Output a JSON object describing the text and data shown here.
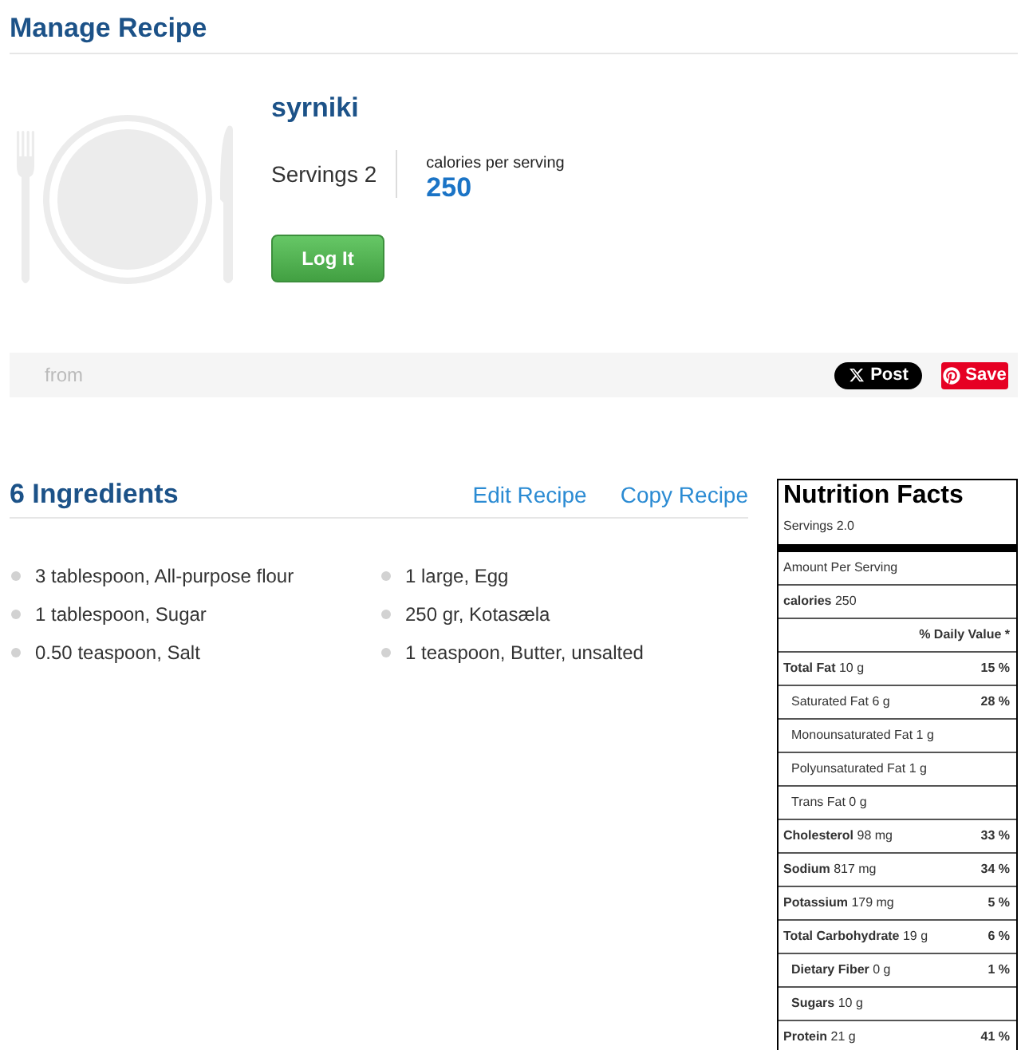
{
  "page_title": "Manage Recipe",
  "recipe": {
    "name": "syrniki",
    "servings": "Servings 2",
    "calories_label": "calories per serving",
    "calories": "250",
    "log_button": "Log It"
  },
  "share_bar": {
    "source": "from",
    "buttons": [
      {
        "kind": "x",
        "label": "Post"
      },
      {
        "kind": "pinterest",
        "label": "Save"
      }
    ]
  },
  "ingredients": {
    "title": "6 Ingredients",
    "links": [
      "Edit Recipe",
      "Copy Recipe"
    ],
    "items": [
      "3 tablespoon, All-purpose flour",
      "1 tablespoon, Sugar",
      "0.50 teaspoon, Salt",
      "1 large, Egg",
      "250 gr, Kotasæla",
      "1 teaspoon, Butter, unsalted"
    ]
  },
  "nutrition_facts": {
    "title": "Nutrition Facts",
    "servings": "Servings 2.0",
    "amount_per_serving": "Amount Per Serving",
    "calories": "**calories** 250",
    "daily_value_header": "% Daily Value *",
    "nutrients": [
      {
        "label": "**Total Fat** 10 g",
        "daily_value": "15 %",
        "children": [
          {
            "label": "Saturated Fat 6 g",
            "daily_value": "28 %"
          },
          {
            "label": "Monounsaturated Fat 1 g"
          },
          {
            "label": "Polyunsaturated Fat 1 g"
          },
          {
            "label": "Trans Fat 0 g"
          }
        ]
      },
      {
        "label": "**Cholesterol** 98 mg",
        "daily_value": "33 %"
      },
      {
        "label": "**Sodium** 817 mg",
        "daily_value": "34 %"
      },
      {
        "label": "**Potassium** 179 mg",
        "daily_value": "5 %"
      },
      {
        "label": "**Total Carbohydrate** 19 g",
        "daily_value": "6 %",
        "children": [
          {
            "label": "**Dietary Fiber** 0 g",
            "daily_value": "1 %"
          },
          {
            "label": "**Sugars** 10 g"
          }
        ]
      },
      {
        "label": "**Protein** 21 g",
        "daily_value": "41 %"
      }
    ]
  }
}
